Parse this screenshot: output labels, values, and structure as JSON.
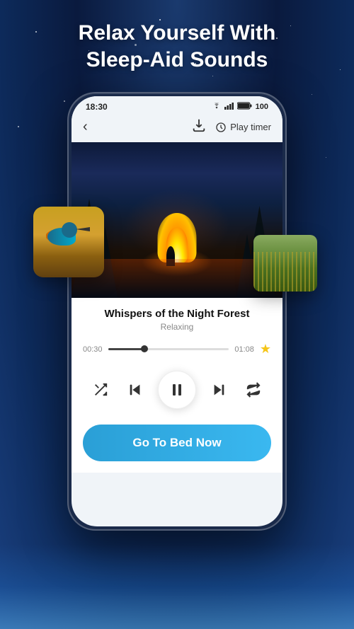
{
  "background": {
    "gradient_start": "#1a3a6e",
    "gradient_end": "#0a1a3e"
  },
  "hero": {
    "title_line1": "Relax Yourself With",
    "title_line2": "Sleep-Aid Sounds",
    "title_full": "Relax Yourself With Sleep-Aid Sounds"
  },
  "status_bar": {
    "time": "18:30",
    "battery": "100",
    "wifi": "WiFi",
    "signal": "Signal"
  },
  "header": {
    "back_label": "‹",
    "download_label": "⬇",
    "play_timer_label": "Play timer"
  },
  "track": {
    "title": "Whispers of the Night Forest",
    "subtitle": "Relaxing",
    "current_time": "00:30",
    "total_time": "01:08",
    "progress_percent": 30
  },
  "controls": {
    "shuffle_label": "Shuffle",
    "prev_label": "Previous",
    "pause_label": "Pause",
    "next_label": "Next",
    "repeat_label": "Repeat"
  },
  "cta": {
    "button_label": "Go To Bed Now"
  }
}
